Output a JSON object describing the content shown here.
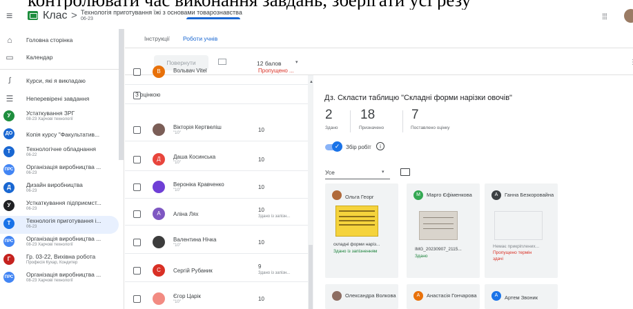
{
  "caption": "контролювати час виконання завдань, зберігати усі резу",
  "topbar": {
    "menu_glyph": "≡",
    "class_label": "Клас",
    "crumb_separator": ">",
    "course_title": "Технологія приготування їжі з основами товарознавства",
    "course_sub": "06-23",
    "apps_glyph": "⁞⁞⁞"
  },
  "sidebar": {
    "nav": [
      {
        "icon": "home-icon",
        "glyph": "⌂",
        "label": "Головна сторінка"
      },
      {
        "icon": "calendar-icon",
        "glyph": "▭",
        "label": "Календар"
      },
      {
        "icon": "people-icon",
        "glyph": "ꭍ",
        "label": "Курси, які я викладаю"
      },
      {
        "icon": "tasks-icon",
        "glyph": "☰",
        "label": "Неперевірені завдання"
      }
    ],
    "courses": [
      {
        "letter": "У",
        "color": "#1e8e3e",
        "name": "Устаткування ЗРГ",
        "sub": "08-23 Харчові технології"
      },
      {
        "letter": "ДО",
        "color": "#1967d2",
        "name": "Копія курсу \"Факультатив...",
        "sub": ""
      },
      {
        "letter": "Т",
        "color": "#1967d2",
        "name": "Технологічне обладнання",
        "sub": "06-22"
      },
      {
        "letter": "ПРС",
        "color": "#4285f4",
        "name": "Організація виробництва ...",
        "sub": "06-23"
      },
      {
        "letter": "Д",
        "color": "#1967d2",
        "name": "Дизайн виробництва",
        "sub": "06-23"
      },
      {
        "letter": "У",
        "color": "#202124",
        "name": "Усткаткування підприємст...",
        "sub": "06-23"
      },
      {
        "letter": "Т",
        "color": "#1a73e8",
        "name": "Технологія приготування і...",
        "sub": "06-23"
      },
      {
        "letter": "ПРС",
        "color": "#4285f4",
        "name": "Організація виробництва ...",
        "sub": "08-23 Харчові технології"
      },
      {
        "letter": "Г",
        "color": "#c5221f",
        "name": "Гр. 03-22, Вихівна робота",
        "sub": "Професія Кухар, Кондитер"
      },
      {
        "letter": "ПРС",
        "color": "#4285f4",
        "name": "Організація виробництва ...",
        "sub": "08-23 Харчові технології"
      }
    ]
  },
  "tabs": [
    {
      "label": "Інструкції"
    },
    {
      "label": "Роботи учнів"
    }
  ],
  "toolbar": {
    "return_label": "Повернути",
    "points_label": "12 балов",
    "caret": "▾",
    "more_glyph": "⋮"
  },
  "students": {
    "partial_top": {
      "letter": "В",
      "color": "#e8710a",
      "name": "Вольвач Vitel",
      "status": "Пропущено ..."
    },
    "section_label": "З оцінкою",
    "rows": [
      {
        "letter": "",
        "color": "#7b5e57",
        "name": "Вікторія Кертвеліш",
        "sub": "\"10\"",
        "grade": "10",
        "grade_sub": ""
      },
      {
        "letter": "Д",
        "color": "#e8453c",
        "name": "Даша Косинська",
        "sub": "\"10\"",
        "grade": "10",
        "grade_sub": ""
      },
      {
        "letter": "",
        "color": "#6f3fd6",
        "name": "Вероніка Кравченко",
        "sub": "\"10\"",
        "grade": "10",
        "grade_sub": ""
      },
      {
        "letter": "А",
        "color": "#7e57c2",
        "name": "Аліна Лях",
        "sub": "",
        "grade": "10",
        "grade_sub": "Здано із запізн..."
      },
      {
        "letter": "",
        "color": "#3c3c3c",
        "name": "Валентина Нічка",
        "sub": "\"10\"",
        "grade": "10",
        "grade_sub": ""
      },
      {
        "letter": "С",
        "color": "#d93025",
        "name": "Сергій Рубаник",
        "sub": "",
        "grade": "9",
        "grade_sub": "Здано із запізн..."
      },
      {
        "letter": "",
        "color": "#f28b82",
        "name": "Єгор Царік",
        "sub": "\"10\"",
        "grade": "10",
        "grade_sub": ""
      }
    ]
  },
  "assignment": {
    "title": "Дз. Скласти таблицю \"Складні форми нарізки овочів\"",
    "stats": [
      {
        "num": "2",
        "label": "Здано"
      },
      {
        "num": "18",
        "label": "Призначено"
      },
      {
        "num": "7",
        "label": "Поставлено оцінку"
      }
    ],
    "collect_label": "Збір робіт",
    "collect_on": true,
    "filter_label": "Усе",
    "cards": [
      {
        "letter": "",
        "color": "#b06a3b",
        "name": "Ольга Георг",
        "file": "складні форми наріз...",
        "status": "Здано із запізненням",
        "status_class": "green",
        "status2": "",
        "thumb": "yellow"
      },
      {
        "letter": "М",
        "color": "#34a853",
        "name": "Марго Єфіменкова",
        "file": "IMG_20230907_2115...",
        "status": "Здано",
        "status_class": "green",
        "status2": "",
        "thumb": "paper"
      },
      {
        "letter": "А",
        "color": "#3c4043",
        "name": "Ганна Безкоровайна",
        "file": "Немає прикріплених...",
        "status": "Пропущено термін",
        "status_class": "red",
        "status2": "здачі",
        "thumb": "none"
      },
      {
        "letter": "",
        "color": "#8d6e63",
        "name": "Олександра Волкова",
        "file": "",
        "status": "",
        "status_class": "",
        "status2": "",
        "thumb": ""
      },
      {
        "letter": "А",
        "color": "#e8710a",
        "name": "Анастасія Гончарова",
        "file": "",
        "status": "",
        "status_class": "",
        "status2": "",
        "thumb": ""
      },
      {
        "letter": "А",
        "color": "#1a73e8",
        "name": "Артем Звоник",
        "file": "",
        "status": "",
        "status_class": "",
        "status2": "",
        "thumb": ""
      }
    ]
  }
}
